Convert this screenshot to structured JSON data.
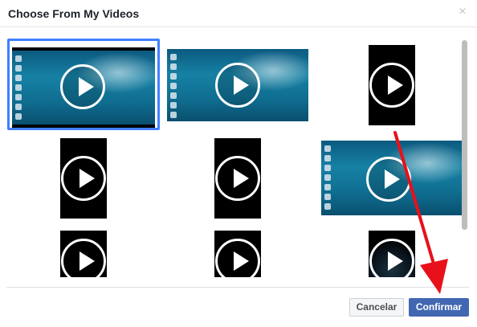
{
  "dialog": {
    "title": "Choose From My Videos",
    "close_glyph": "×"
  },
  "videos": [
    {
      "kind": "landscape-ocean",
      "selected": true
    },
    {
      "kind": "landscape-ocean",
      "selected": false
    },
    {
      "kind": "portrait-black",
      "selected": false
    },
    {
      "kind": "portrait-black",
      "selected": false
    },
    {
      "kind": "portrait-black",
      "selected": false
    },
    {
      "kind": "landscape-ocean",
      "selected": false
    },
    {
      "kind": "portrait-black",
      "selected": false
    },
    {
      "kind": "portrait-black",
      "selected": false
    },
    {
      "kind": "portrait-dark-clock",
      "selected": false
    }
  ],
  "footer": {
    "cancel_label": "Cancelar",
    "confirm_label": "Confirmar"
  },
  "colors": {
    "selection": "#4080ff",
    "confirm_bg": "#4267b2",
    "annotation_arrow": "#e8101a"
  }
}
